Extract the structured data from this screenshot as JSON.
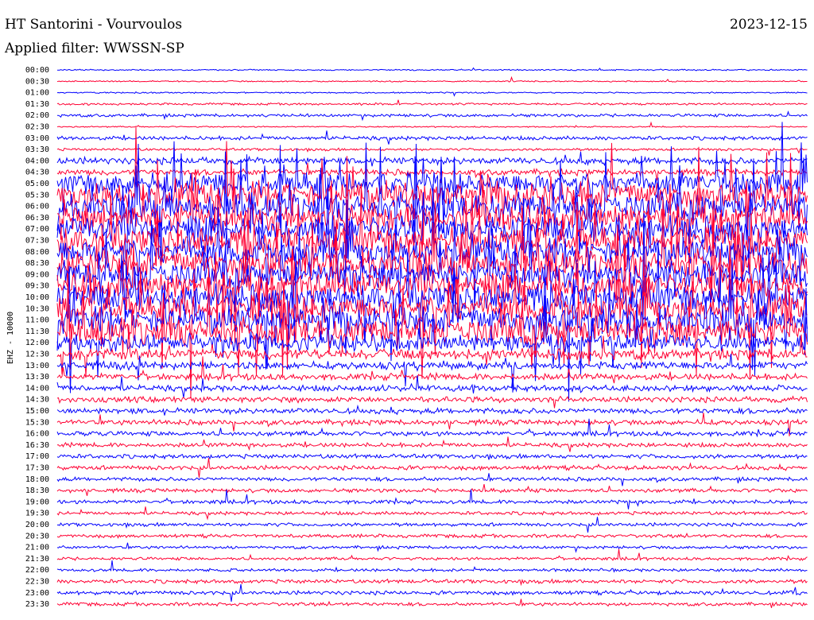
{
  "header": {
    "station": "HT Santorini - Vourvoulos",
    "date": "2023-12-15",
    "filter": "Applied filter: WWSSN-SP"
  },
  "chart_data": {
    "type": "line",
    "title": "HT Santorini - Vourvoulos",
    "ylabel": "EHZ - 10000",
    "xlabel": "",
    "row_labels": [
      "00:00",
      "00:30",
      "01:00",
      "01:30",
      "02:00",
      "02:30",
      "03:00",
      "03:30",
      "04:00",
      "04:30",
      "05:00",
      "05:30",
      "06:00",
      "06:30",
      "07:00",
      "07:30",
      "08:00",
      "08:30",
      "09:00",
      "09:30",
      "10:00",
      "10:30",
      "11:00",
      "11:30",
      "12:00",
      "12:30",
      "13:00",
      "13:30",
      "14:00",
      "14:30",
      "15:00",
      "15:30",
      "16:00",
      "16:30",
      "17:00",
      "17:30",
      "18:00",
      "18:30",
      "19:00",
      "19:30",
      "20:00",
      "20:30",
      "21:00",
      "21:30",
      "22:00",
      "22:30",
      "23:00",
      "23:30"
    ],
    "series_colors": [
      "#0000ff",
      "#ff0033"
    ],
    "grid": false,
    "activity_level": [
      0.3,
      0.3,
      0.3,
      0.5,
      0.7,
      0.3,
      0.9,
      0.6,
      1.6,
      1.4,
      5,
      6,
      6,
      6,
      6,
      6,
      6,
      6,
      6,
      6,
      6,
      6,
      6,
      6,
      4,
      2.5,
      1.8,
      1.5,
      1.4,
      1.3,
      1.3,
      1.2,
      1.1,
      1.0,
      1.0,
      1.0,
      0.9,
      0.9,
      0.9,
      0.8,
      0.8,
      0.8,
      0.7,
      0.7,
      0.7,
      0.9,
      0.9,
      0.8
    ]
  }
}
